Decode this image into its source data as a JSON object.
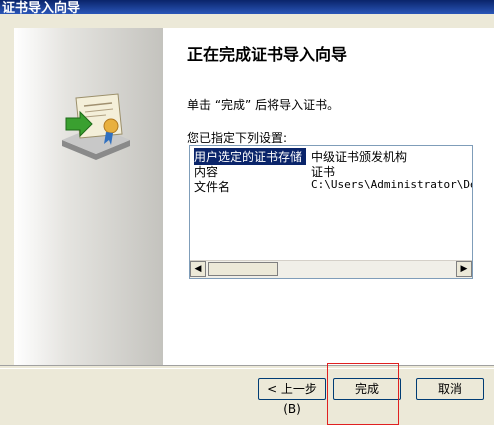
{
  "window": {
    "title": "证书导入向导"
  },
  "wizard": {
    "heading": "正在完成证书导入向导",
    "instruction": "单击 “完成” 后将导入证书。",
    "settings_label": "您已指定下列设置:",
    "settings": [
      {
        "name": "用户选定的证书存储",
        "value": "中级证书颁发机构"
      },
      {
        "name": "内容",
        "value": "证书"
      },
      {
        "name": "文件名",
        "value": "C:\\Users\\Administrator\\Desk"
      }
    ]
  },
  "buttons": {
    "back": "< 上一步(B)",
    "finish": "完成",
    "cancel": "取消"
  },
  "icons": {
    "wizard_illustration": "certificate-import-icon",
    "scroll_left": "arrow-left-icon",
    "scroll_right": "arrow-right-icon"
  },
  "colors": {
    "title_bar": "#0a246a",
    "selection": "#0a246a",
    "highlight_box": "#e02020"
  }
}
